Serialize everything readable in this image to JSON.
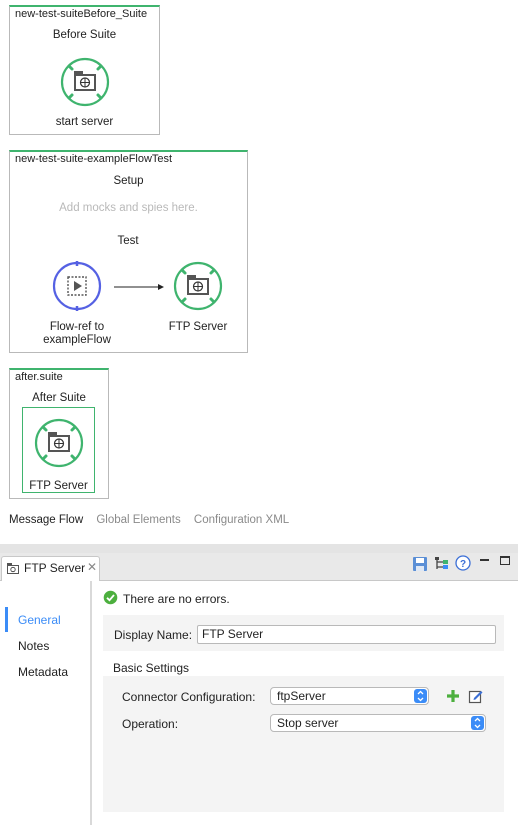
{
  "canvas": {
    "scopes": [
      {
        "title": "new-test-suiteBefore_Suite",
        "section": "Before Suite",
        "node_label": "start server"
      },
      {
        "title": "new-test-suite-exampleFlowTest",
        "setup": "Setup",
        "hint": "Add mocks and spies here.",
        "test": "Test",
        "flowref_label_1": "Flow-ref to",
        "flowref_label_2": "exampleFlow",
        "ftp_label": "FTP Server"
      },
      {
        "title": "after.suite",
        "section": "After Suite",
        "node_label": "FTP Server"
      }
    ],
    "tabs": [
      "Message Flow",
      "Global Elements",
      "Configuration XML"
    ],
    "colors": {
      "scope_border": "#3fb46e",
      "connector_ring": "#3fb46e",
      "flowref_ring": "#5561e3"
    }
  },
  "editor": {
    "tab_title": "FTP Server",
    "status": "There are no errors.",
    "nav": [
      "General",
      "Notes",
      "Metadata"
    ],
    "display_name_label": "Display Name:",
    "display_name_value": "FTP Server",
    "basic_settings": "Basic Settings",
    "connector_config_label": "Connector Configuration:",
    "connector_config_value": "ftpServer",
    "operation_label": "Operation:",
    "operation_value": "Stop server",
    "icons": [
      "save-icon",
      "tree-icon",
      "help-icon",
      "minimize-icon",
      "maximize-icon",
      "add-icon",
      "edit-icon"
    ]
  }
}
